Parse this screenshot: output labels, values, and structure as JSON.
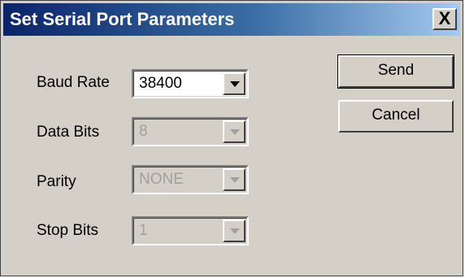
{
  "window": {
    "title": "Set Serial Port Parameters",
    "close_label": "X"
  },
  "fields": {
    "baud_rate": {
      "label": "Baud Rate",
      "value": "38400",
      "enabled": true
    },
    "data_bits": {
      "label": "Data Bits",
      "value": "8",
      "enabled": false
    },
    "parity": {
      "label": "Parity",
      "value": "NONE",
      "enabled": false
    },
    "stop_bits": {
      "label": "Stop Bits",
      "value": "1",
      "enabled": false
    }
  },
  "buttons": {
    "send_label": "Send",
    "cancel_label": "Cancel"
  },
  "icons": {
    "close": "close-icon",
    "dropdown": "chevron-down-icon"
  },
  "colors": {
    "title_bar_start": "#0a246a",
    "title_bar_end": "#a6caf0",
    "dialog_bg": "#d4d0c8",
    "disabled_text": "#a0a0a0"
  }
}
